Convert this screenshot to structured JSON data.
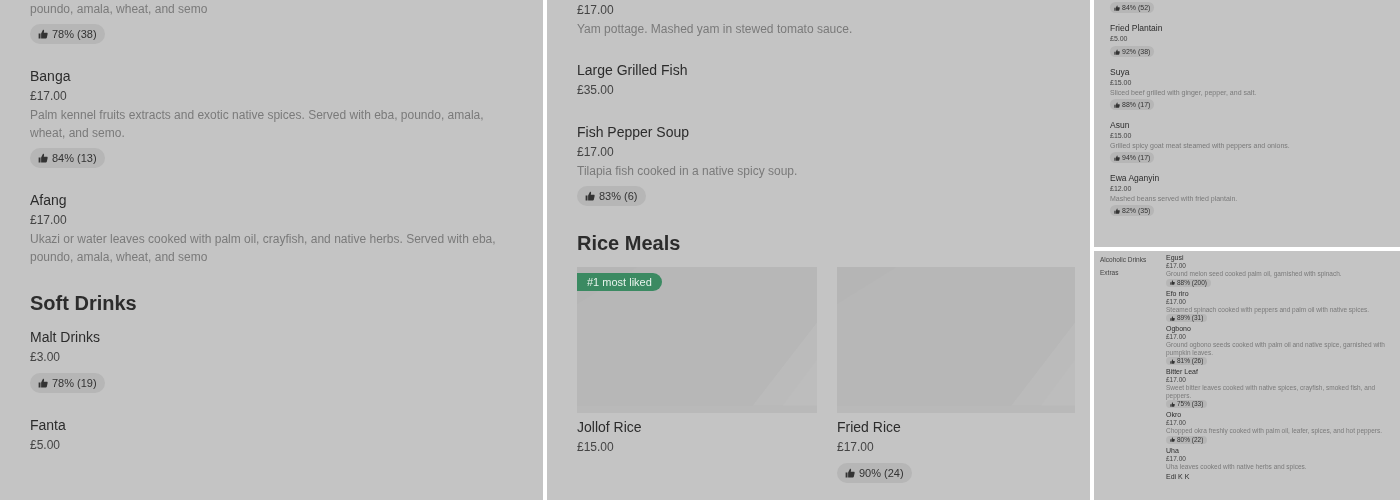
{
  "panels": [
    {
      "blocks": [
        {
          "kind": "item",
          "description": "poundo, amala, wheat, and semo",
          "rating": "78% (38)"
        },
        {
          "kind": "item",
          "name": "Banga",
          "price": "£17.00",
          "description": "Palm kennel fruits extracts and exotic native spices. Served with eba, poundo, amala, wheat, and semo.",
          "rating": "84% (13)"
        },
        {
          "kind": "item",
          "name": "Afang",
          "price": "£17.00",
          "description": "Ukazi or water leaves cooked with palm oil, crayfish, and native herbs. Served with eba, poundo, amala, wheat, and semo"
        },
        {
          "kind": "heading",
          "text": "Soft Drinks"
        },
        {
          "kind": "item",
          "name": "Malt Drinks",
          "price": "£3.00",
          "rating": "78% (19)"
        },
        {
          "kind": "item",
          "name": "Fanta",
          "price": "£5.00"
        }
      ]
    },
    {
      "blocks": [
        {
          "kind": "item",
          "price": "£17.00",
          "description": "Yam pottage. Mashed yam in stewed tomato sauce."
        },
        {
          "kind": "item",
          "name": "Large Grilled Fish",
          "price": "£35.00"
        },
        {
          "kind": "item",
          "name": "Fish Pepper Soup",
          "price": "£17.00",
          "description": "Tilapia fish cooked in a native spicy soup.",
          "rating": "83% (6)"
        },
        {
          "kind": "heading",
          "text": "Rice Meals"
        },
        {
          "kind": "cards",
          "cards": [
            {
              "badge": "#1 most liked",
              "name": "Jollof Rice",
              "price": "£15.00"
            },
            {
              "name": "Fried Rice",
              "price": "£17.00",
              "rating": "90% (24)"
            }
          ]
        }
      ]
    },
    {
      "blocks": [
        {
          "kind": "item",
          "rating": "84% (52)"
        },
        {
          "kind": "item",
          "name": "Fried Plantain",
          "price": "£5.00",
          "rating": "92% (38)"
        },
        {
          "kind": "item",
          "name": "Suya",
          "price": "£15.00",
          "description": "Sliced beef grilled with ginger, pepper, and salt.",
          "rating": "88% (17)"
        },
        {
          "kind": "item",
          "name": "Asun",
          "price": "£15.00",
          "description": "Grilled spicy goat meat steamed with peppers and onions.",
          "rating": "94% (17)"
        },
        {
          "kind": "item",
          "name": "Ewa Aganyin",
          "price": "£12.00",
          "description": "Mashed beans served with fried plantain.",
          "rating": "82% (35)"
        }
      ]
    },
    {
      "nav": [
        "Alcoholic Drinks",
        "Extras"
      ],
      "blocks": [
        {
          "kind": "item",
          "name": "Egusi",
          "price": "£17.00",
          "description": "Ground melon seed cooked palm oil, garnished with spinach.",
          "rating": "88% (200)"
        },
        {
          "kind": "item",
          "name": "Efo riro",
          "price": "£17.00",
          "description": "Steamed spinach cooked with peppers and palm oil with native spices.",
          "rating": "89% (31)"
        },
        {
          "kind": "item",
          "name": "Ogbono",
          "price": "£17.00",
          "description": "Ground ogbono seeds cooked with palm oil and native spice, garnished with pumpkin leaves.",
          "rating": "81% (26)"
        },
        {
          "kind": "item",
          "name": "Bitter Leaf",
          "price": "£17.00",
          "description": "Sweet bitter leaves cooked with native spices, crayfish, smoked fish, and peppers.",
          "rating": "75% (33)"
        },
        {
          "kind": "item",
          "name": "Okro",
          "price": "£17.00",
          "description": "Chopped okra freshly cooked with palm oil, leafer, spices, and hot peppers.",
          "rating": "80% (22)"
        },
        {
          "kind": "item",
          "name": "Uha",
          "price": "£17.00",
          "description": "Uha leaves cooked with native herbs and spices."
        },
        {
          "kind": "item",
          "name": "Edi K K"
        }
      ]
    }
  ]
}
